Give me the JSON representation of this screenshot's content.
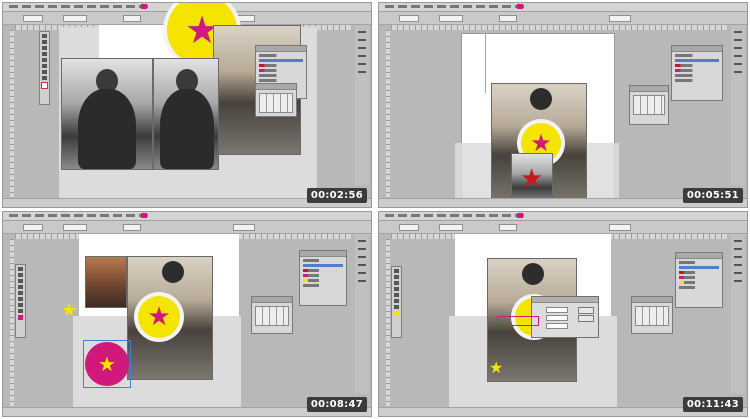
{
  "screens": [
    {
      "timecode": "00:02:56"
    },
    {
      "timecode": "00:05:51"
    },
    {
      "timecode": "00:08:47"
    },
    {
      "timecode": "00:11:43"
    }
  ],
  "icons": {
    "star": "star-icon",
    "circle": "circle-frame"
  },
  "colors": {
    "yellow": "#f4e400",
    "magenta": "#d0197a",
    "red": "#c31b1b",
    "ui_gray": "#b8b8b8",
    "panel_gray": "#d8d8d8",
    "selection_blue": "#4f7fc8",
    "timecode_bg": "#3c3c3c"
  },
  "glyphs": {
    "star": "★"
  }
}
